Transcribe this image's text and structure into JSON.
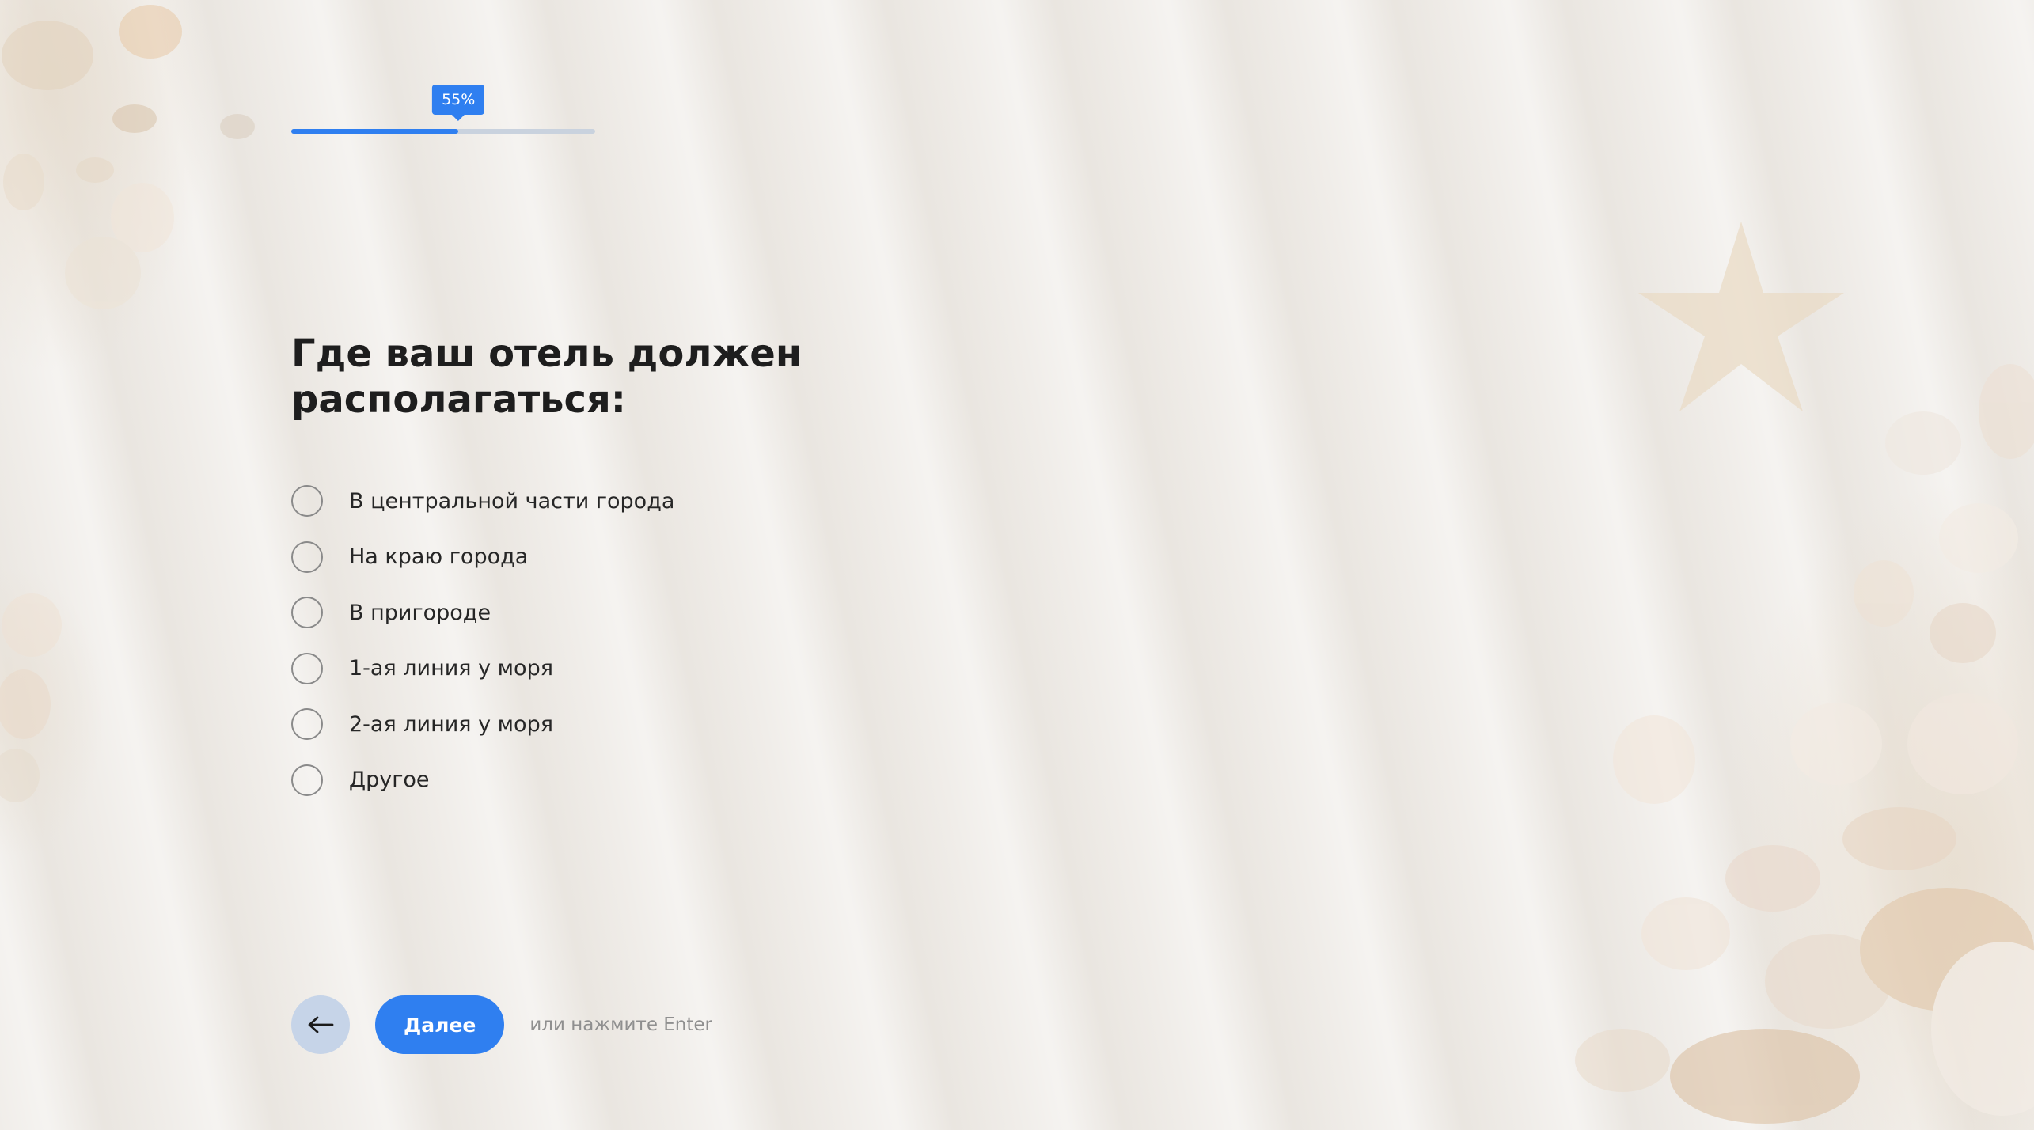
{
  "progress": {
    "percent": 55,
    "label": "55%"
  },
  "question": {
    "title": "Где ваш отель должен располагаться:"
  },
  "options": [
    {
      "label": "В центральной части города"
    },
    {
      "label": "На краю города"
    },
    {
      "label": "В пригороде"
    },
    {
      "label": "1-ая линия у моря"
    },
    {
      "label": "2-ая линия у моря"
    },
    {
      "label": "Другое"
    }
  ],
  "navigation": {
    "back_icon": "arrow-left-icon",
    "next_label": "Далее",
    "hint": "или нажмите Enter"
  },
  "colors": {
    "accent": "#2f7ff0",
    "back_button_bg": "#c6d4e8",
    "background": "#f0ede9"
  }
}
